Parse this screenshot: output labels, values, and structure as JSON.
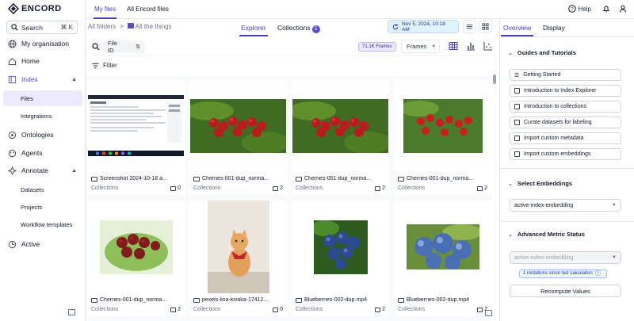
{
  "app": {
    "logo_text": "ENCORD"
  },
  "sidebar": {
    "search_label": "Search",
    "search_shortcut": "⌘ K",
    "items": [
      {
        "label": "My organisation"
      },
      {
        "label": "Home"
      },
      {
        "label": "Index"
      },
      {
        "label": "Files"
      },
      {
        "label": "Integrations"
      },
      {
        "label": "Ontologies"
      },
      {
        "label": "Agents"
      },
      {
        "label": "Annotate"
      },
      {
        "label": "Datasets"
      },
      {
        "label": "Projects"
      },
      {
        "label": "Workflow templates"
      },
      {
        "label": "Active"
      }
    ]
  },
  "topbar": {
    "tabs": [
      "My files",
      "All Encord files"
    ],
    "help_label": "Help"
  },
  "explorer": {
    "breadcrumb": [
      "All folders",
      ">",
      "All the things"
    ],
    "view_tabs": [
      "Explorer",
      "Collections"
    ],
    "collections_count": "5",
    "date_label": "Nov 5, 2024, 10:18 AM",
    "filter_field": "File ID",
    "frames_badge": "71.1K Frames",
    "frames_select": "Frames",
    "filter_label": "Filter"
  },
  "cards": [
    {
      "name": "Screenshot 2024-10-18 a...",
      "sub": "Collections",
      "count": "0",
      "type": "image"
    },
    {
      "name": "Cherries-001-dup_norma...",
      "sub": "Collections",
      "count": "2",
      "type": "video"
    },
    {
      "name": "Cherries-001-dup_norma...",
      "sub": "Collections",
      "count": "2",
      "type": "video"
    },
    {
      "name": "Cherries-001-dup_norma...",
      "sub": "Collections",
      "count": "2",
      "type": "video"
    },
    {
      "name": "Cherries-001-dup_norma...",
      "sub": "Collections",
      "count": "2",
      "type": "video"
    },
    {
      "name": "pexels-lina-kivaka-17412...",
      "sub": "Collections",
      "count": "0",
      "type": "image"
    },
    {
      "name": "Blueberries-002-dup.mp4",
      "sub": "Collections",
      "count": "2",
      "type": "video"
    },
    {
      "name": "Blueberries-002-dup.mp4",
      "sub": "Collections",
      "count": "2",
      "type": "video"
    }
  ],
  "panel": {
    "tabs": [
      "Overview",
      "Display"
    ],
    "guides_title": "Guides and Tutorials",
    "guides": [
      "Getting Started",
      "Introduction to Index Explorer",
      "Introduction to collections",
      "Curate datasets for labeling",
      "Import custom metadata",
      "Import custom embeddings"
    ],
    "embeddings_title": "Select Embeddings",
    "embedding_value": "active-index-embedding",
    "metric_title": "Advanced Metric Status",
    "metric_value": "active-index-embedding",
    "mutations_text": "1 mutations since last calculation",
    "recompute_label": "Recompute Values"
  },
  "colors": {
    "accent": "#4c3fbf",
    "selected_bg": "#ede9fe",
    "date_bg": "#e0f2fe"
  }
}
